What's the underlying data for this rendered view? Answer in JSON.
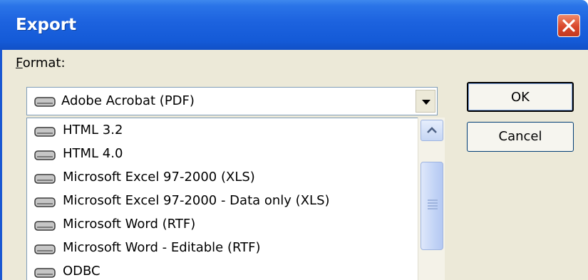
{
  "window": {
    "title": "Export"
  },
  "format": {
    "label": "Format:",
    "label_accel_char": "F",
    "label_rest": "ormat:",
    "selected": "Adobe Acrobat (PDF)",
    "options": [
      "HTML 3.2",
      "HTML 4.0",
      "Microsoft Excel 97-2000 (XLS)",
      "Microsoft Excel 97-2000 - Data only (XLS)",
      "Microsoft Word (RTF)",
      "Microsoft Word - Editable (RTF)",
      "ODBC"
    ],
    "item_icon": "drive-icon"
  },
  "buttons": {
    "ok": "OK",
    "cancel": "Cancel"
  },
  "colors": {
    "titlebar": "#145ad7",
    "close": "#d9472b",
    "face": "#ece9d8",
    "border": "#7f9db9"
  }
}
